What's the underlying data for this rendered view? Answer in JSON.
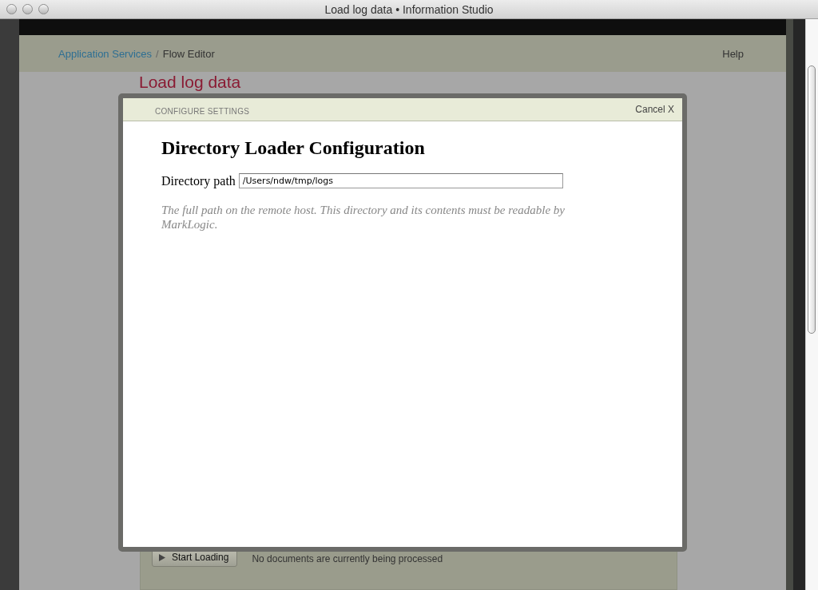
{
  "window": {
    "title": "Load log data • Information Studio"
  },
  "breadcrumb": [
    {
      "label": "Application Services",
      "kind": "link"
    },
    {
      "label": "Flow Editor",
      "kind": "current"
    }
  ],
  "breadcrumb_separator": "/",
  "help": "Help",
  "page": {
    "title": "Load log data",
    "start_button": "Start Loading",
    "status": "No documents are currently being processed"
  },
  "dialog": {
    "section": "CONFIGURE SETTINGS",
    "cancel": "Cancel X",
    "heading": "Directory Loader Configuration",
    "field_label": "Directory path",
    "field_value": "/Users/ndw/tmp/logs",
    "hint": "The full path on the remote host. This directory and its contents must be readable by MarkLogic."
  }
}
